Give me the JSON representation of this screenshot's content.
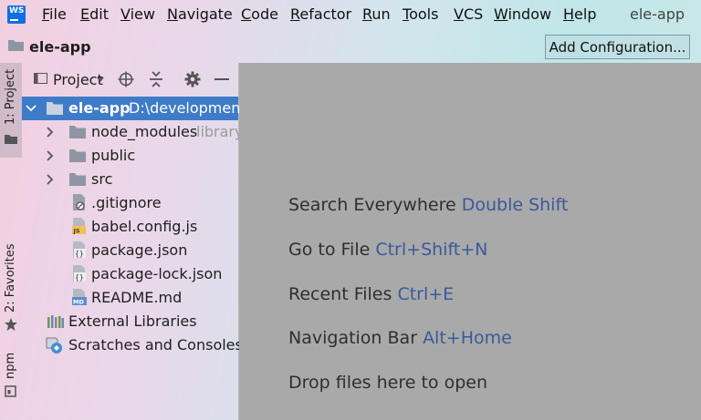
{
  "menubar": {
    "logo_text": "WS",
    "items": [
      {
        "mnemonic": "F",
        "rest": "ile"
      },
      {
        "mnemonic": "E",
        "rest": "dit"
      },
      {
        "mnemonic": "V",
        "rest": "iew"
      },
      {
        "mnemonic": "N",
        "rest": "avigate"
      },
      {
        "mnemonic": "C",
        "rest": "ode"
      },
      {
        "mnemonic": "R",
        "rest": "efactor"
      },
      {
        "mnemonic": "R",
        "rest": "un"
      },
      {
        "mnemonic": "T",
        "rest": "ools"
      },
      {
        "mnemonic": "V",
        "rest": "CS"
      },
      {
        "mnemonic": "W",
        "rest": "indow"
      },
      {
        "mnemonic": "H",
        "rest": "elp"
      }
    ],
    "window_title": "ele-app"
  },
  "navbar": {
    "breadcrumb": "ele-app",
    "add_configuration": "Add Configuration..."
  },
  "left_strip": {
    "project_tab": "1: Project",
    "favorites_tab": "2: Favorites",
    "npm_tab": "npm"
  },
  "project_panel": {
    "title": "Project",
    "tree": [
      {
        "label": "ele-app",
        "hint": "D:\\development\\",
        "kind": "folder",
        "selected": true,
        "arrow": "down"
      },
      {
        "label": "node_modules",
        "hint": "library",
        "kind": "folder",
        "arrow": "right"
      },
      {
        "label": "public",
        "hint": "",
        "kind": "folder",
        "arrow": "right"
      },
      {
        "label": "src",
        "hint": "",
        "kind": "folder",
        "arrow": "right"
      },
      {
        "label": ".gitignore",
        "hint": "",
        "kind": "file-ignore"
      },
      {
        "label": "babel.config.js",
        "hint": "",
        "kind": "file-js"
      },
      {
        "label": "package.json",
        "hint": "",
        "kind": "file-json"
      },
      {
        "label": "package-lock.json",
        "hint": "",
        "kind": "file-json"
      },
      {
        "label": "README.md",
        "hint": "",
        "kind": "file-md"
      },
      {
        "label": "External Libraries",
        "hint": "",
        "kind": "libraries"
      },
      {
        "label": "Scratches and Consoles",
        "hint": "",
        "kind": "scratches"
      }
    ]
  },
  "editor": {
    "tips": [
      {
        "text": "Search Everywhere",
        "shortcut": "Double Shift"
      },
      {
        "text": "Go to File",
        "shortcut": "Ctrl+Shift+N"
      },
      {
        "text": "Recent Files",
        "shortcut": "Ctrl+E"
      },
      {
        "text": "Navigation Bar",
        "shortcut": "Alt+Home"
      },
      {
        "text": "Drop files here to open",
        "shortcut": ""
      }
    ]
  },
  "colors": {
    "selection": "#3e7bc8",
    "editor_bg": "#a9a9a9",
    "shortcut": "#3a5a9a",
    "folder": "#8e96a3"
  }
}
